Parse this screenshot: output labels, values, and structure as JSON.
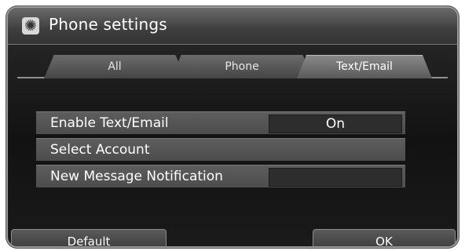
{
  "window": {
    "title": "Phone settings",
    "icon": "gear-icon"
  },
  "tabs": [
    {
      "label": "All",
      "active": false
    },
    {
      "label": "Phone",
      "active": false
    },
    {
      "label": "Text/Email",
      "active": true
    }
  ],
  "settings": [
    {
      "label": "Enable Text/Email",
      "value": "On"
    },
    {
      "label": "Select Account"
    },
    {
      "label": "New Message Notification",
      "value": ""
    }
  ],
  "buttons": {
    "default_label": "Default",
    "ok_label": "OK"
  }
}
